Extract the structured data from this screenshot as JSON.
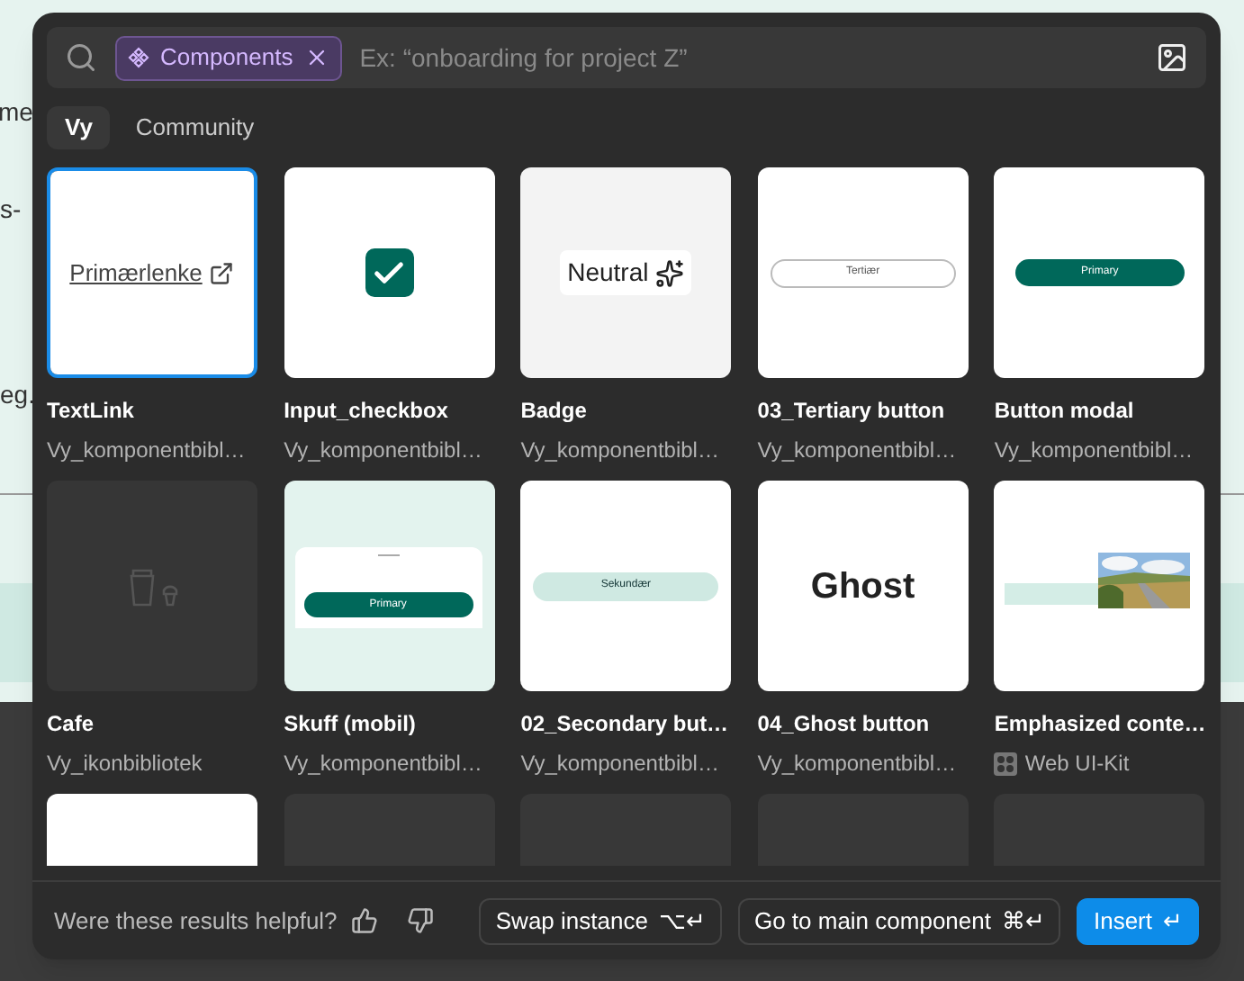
{
  "background": {
    "texts": [
      "me",
      "s-",
      "eg."
    ]
  },
  "search": {
    "chip": {
      "label": "Components"
    },
    "placeholder": "Ex: “onboarding for project Z”"
  },
  "tabs": [
    {
      "label": "Vy",
      "selected": true
    },
    {
      "label": "Community",
      "selected": false
    }
  ],
  "results": [
    {
      "title": "TextLink",
      "source": "Vy_komponentbibl…",
      "selected": true,
      "kit_icon": false,
      "preview": {
        "kind": "link",
        "text": "Primærlenke"
      }
    },
    {
      "title": "Input_checkbox",
      "source": "Vy_komponentbibl…",
      "selected": false,
      "kit_icon": false,
      "preview": {
        "kind": "checkbox"
      }
    },
    {
      "title": "Badge",
      "source": "Vy_komponentbibl…",
      "selected": false,
      "kit_icon": false,
      "preview": {
        "kind": "badge",
        "text": "Neutral"
      }
    },
    {
      "title": "03_Tertiary button",
      "source": "Vy_komponentbibl…",
      "selected": false,
      "kit_icon": false,
      "preview": {
        "kind": "tertiary",
        "text": "Tertiær"
      }
    },
    {
      "title": "Button modal",
      "source": "Vy_komponentbibl…",
      "selected": false,
      "kit_icon": false,
      "preview": {
        "kind": "primary",
        "text": "Primary"
      }
    },
    {
      "title": "Cafe",
      "source": "Vy_ikonbibliotek",
      "selected": false,
      "kit_icon": false,
      "preview": {
        "kind": "icon"
      }
    },
    {
      "title": "Skuff (mobil)",
      "source": "Vy_komponentbibl…",
      "selected": false,
      "kit_icon": false,
      "preview": {
        "kind": "sheet",
        "text": "Primary"
      }
    },
    {
      "title": "02_Secondary but…",
      "source": "Vy_komponentbibl…",
      "selected": false,
      "kit_icon": false,
      "preview": {
        "kind": "secondary",
        "text": "Sekundær"
      }
    },
    {
      "title": "04_Ghost button",
      "source": "Vy_komponentbibl…",
      "selected": false,
      "kit_icon": false,
      "preview": {
        "kind": "ghost",
        "text": "Ghost"
      }
    },
    {
      "title": "Emphasized conte…",
      "source": "Web UI-Kit",
      "selected": false,
      "kit_icon": true,
      "preview": {
        "kind": "emphasized"
      }
    }
  ],
  "more_cards": [
    {
      "kind": "white"
    },
    {
      "kind": "empty"
    },
    {
      "kind": "empty"
    },
    {
      "kind": "empty"
    },
    {
      "kind": "empty"
    }
  ],
  "footer": {
    "question": "Were these results helpful?",
    "buttons": [
      {
        "label": "Swap instance",
        "shortcut": "⌥↵",
        "kind": "outline"
      },
      {
        "label": "Go to main component",
        "shortcut": "⌘↵",
        "kind": "outline"
      },
      {
        "label": "Insert",
        "shortcut": "↵",
        "kind": "primary"
      }
    ]
  }
}
